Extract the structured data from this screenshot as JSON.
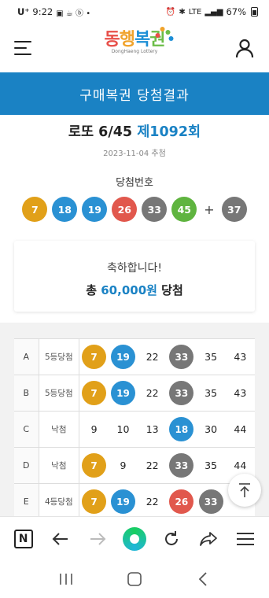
{
  "status_bar": {
    "carrier": "U⁺",
    "time": "9:22",
    "network": "LTE",
    "battery": "67%"
  },
  "header": {
    "logo_text": [
      "동",
      "행",
      "복",
      "권"
    ],
    "logo_sub": "DongHaeng Lottery"
  },
  "title_bar": {
    "title": "구매복권 당첨결과"
  },
  "draw": {
    "game_name": "로또 6/45",
    "round": "제1092회",
    "date": "2023-11-04 추첨",
    "winning_label": "당첨번호",
    "numbers": [
      "7",
      "18",
      "19",
      "26",
      "33",
      "45"
    ],
    "number_colors": [
      "y",
      "b",
      "b",
      "r",
      "g",
      "gr"
    ],
    "plus": "+",
    "bonus": "37",
    "bonus_color": "g"
  },
  "congrats": {
    "message": "축하합니다!",
    "prefix": "총",
    "amount": "60,000원",
    "suffix": "당첨"
  },
  "games": [
    {
      "label": "A",
      "result": "5등당첨",
      "nums": [
        "7",
        "19",
        "22",
        "33",
        "35",
        "43"
      ],
      "balls": [
        "y",
        "b",
        "",
        "g",
        "",
        ""
      ]
    },
    {
      "label": "B",
      "result": "5등당첨",
      "nums": [
        "7",
        "19",
        "22",
        "33",
        "35",
        "43"
      ],
      "balls": [
        "y",
        "b",
        "",
        "g",
        "",
        ""
      ]
    },
    {
      "label": "C",
      "result": "낙첨",
      "nums": [
        "9",
        "10",
        "13",
        "18",
        "30",
        "44"
      ],
      "balls": [
        "",
        "",
        "",
        "b",
        "",
        ""
      ]
    },
    {
      "label": "D",
      "result": "낙첨",
      "nums": [
        "7",
        "9",
        "22",
        "33",
        "35",
        "44"
      ],
      "balls": [
        "y",
        "",
        "",
        "g",
        "",
        ""
      ]
    },
    {
      "label": "E",
      "result": "4등당첨",
      "nums": [
        "7",
        "19",
        "22",
        "26",
        "33",
        ""
      ],
      "balls": [
        "y",
        "b",
        "",
        "r",
        "g",
        ""
      ]
    }
  ],
  "colors": {
    "primary": "#1a82c4",
    "ball_yellow": "#e1a019",
    "ball_blue": "#2a91d3",
    "ball_red": "#e1584d",
    "ball_gray": "#777777",
    "ball_green": "#5fb43f"
  }
}
